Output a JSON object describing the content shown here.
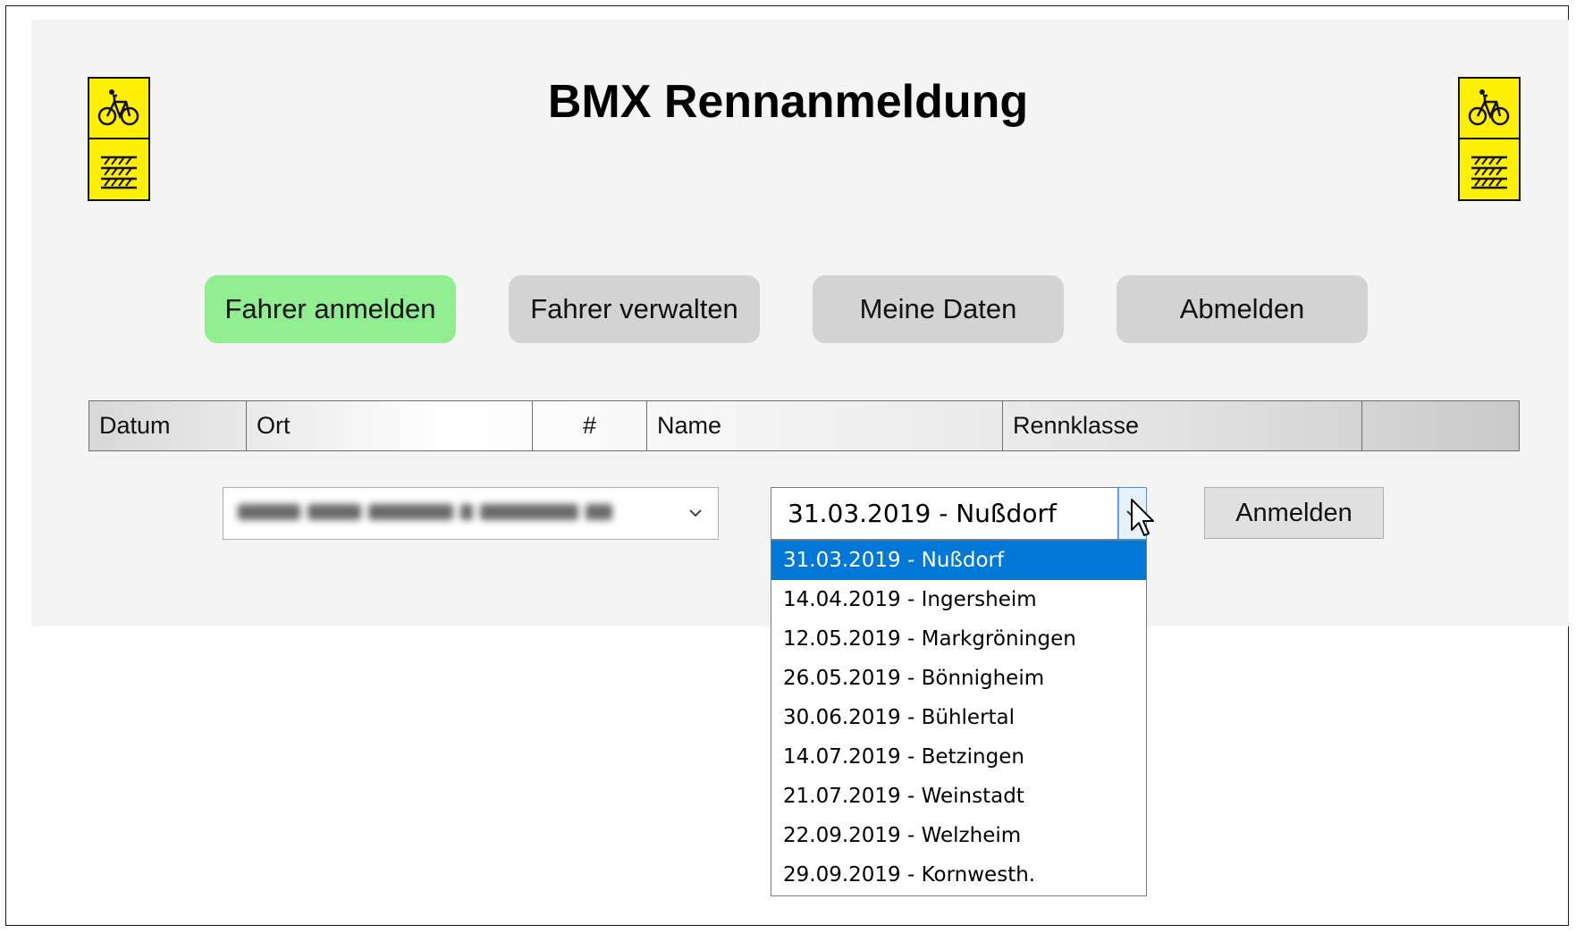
{
  "app": {
    "title": "BMX Rennanmeldung"
  },
  "colors": {
    "active_nav": "#90ee90",
    "nav": "#d3d3d3",
    "logo_yellow": "#ffef00",
    "selection": "#0078d7"
  },
  "logo": {
    "icon_top": "bicycle-icon",
    "icon_bottom": "track-icon"
  },
  "nav": {
    "items": [
      {
        "label": "Fahrer anmelden",
        "active": true
      },
      {
        "label": "Fahrer verwalten",
        "active": false
      },
      {
        "label": "Meine Daten",
        "active": false
      },
      {
        "label": "Abmelden",
        "active": false
      }
    ]
  },
  "table": {
    "headers": [
      "Datum",
      "Ort",
      "#",
      "Name",
      "Rennklasse",
      ""
    ]
  },
  "form": {
    "driver_select": {
      "value": "",
      "blurred": true
    },
    "race_select": {
      "value": "31.03.2019 - Nußdorf"
    },
    "submit_label": "Anmelden"
  },
  "dropdown": {
    "selected_index": 0,
    "options": [
      "31.03.2019 - Nußdorf",
      "14.04.2019 - Ingersheim",
      "12.05.2019 - Markgröningen",
      "26.05.2019 - Bönnigheim",
      "30.06.2019 - Bühlertal",
      "14.07.2019 - Betzingen",
      "21.07.2019 - Weinstadt",
      "22.09.2019 - Welzheim",
      "29.09.2019 - Kornwesth."
    ]
  }
}
